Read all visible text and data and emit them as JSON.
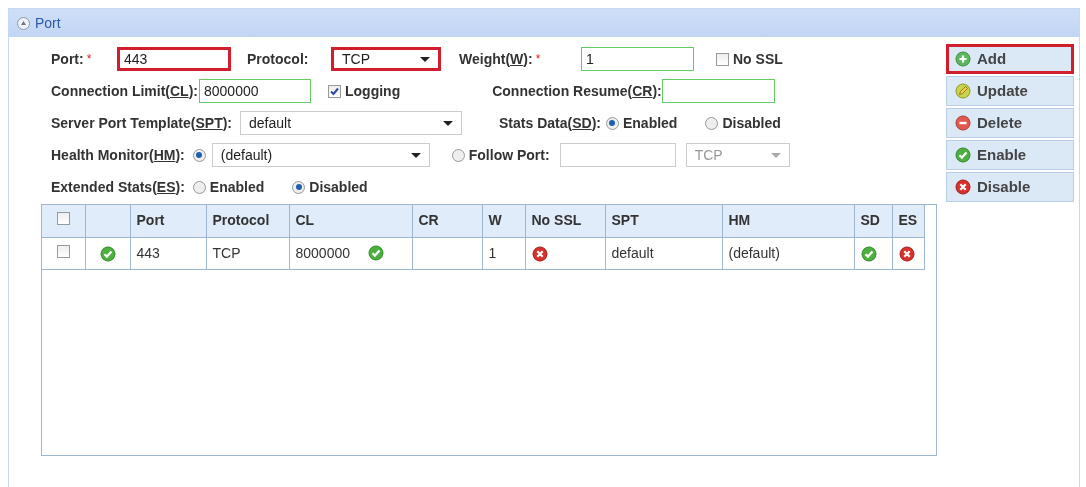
{
  "panel": {
    "title": "Port",
    "collapsed": false
  },
  "form": {
    "port": {
      "label": "Port:",
      "required": "*",
      "value": "443",
      "highlighted": true
    },
    "protocol": {
      "label": "Protocol:",
      "value": "TCP",
      "highlighted": true
    },
    "weight": {
      "label": [
        "Weight(",
        "W",
        "):"
      ],
      "required": "*",
      "value": "1",
      "highlighted": false
    },
    "no_ssl": {
      "label": "No SSL",
      "checked": false
    },
    "connection_limit": {
      "label": [
        "Connection Limit(",
        "CL",
        "):"
      ],
      "value": "8000000",
      "highlighted": false
    },
    "logging": {
      "label": "Logging",
      "checked": true
    },
    "connection_resume": {
      "label": [
        "Connection Resume(",
        "CR",
        "):"
      ],
      "highlighted": false
    },
    "server_port_template": {
      "label": [
        "Server Port Template(",
        "SPT",
        "):"
      ],
      "value": "default"
    },
    "stats_data": {
      "label": [
        "Stats Data(",
        "SD",
        "):"
      ],
      "options": [
        {
          "label": "Enabled",
          "selected": true
        },
        {
          "label": "Disabled",
          "selected": false
        }
      ]
    },
    "health_monitor": {
      "label": [
        "Health Monitor(",
        "HM",
        "):"
      ],
      "options": [
        {
          "kind": "select",
          "value": "(default)",
          "selected": true
        },
        {
          "kind": "follow_port",
          "label": "Follow Port:",
          "protocol": "TCP",
          "selected": false
        }
      ]
    },
    "extended_stats": {
      "label": [
        "Extended Stats(",
        "ES",
        "):"
      ],
      "options": [
        {
          "label": "Enabled",
          "selected": false
        },
        {
          "label": "Disabled",
          "selected": true
        }
      ]
    }
  },
  "buttons": [
    {
      "label": "Add",
      "kind": "add",
      "highlighted": true
    },
    {
      "label": "Update",
      "kind": "update",
      "highlighted": false
    },
    {
      "label": "Delete",
      "kind": "delete",
      "highlighted": false
    },
    {
      "label": "Enable",
      "kind": "enable",
      "highlighted": false
    },
    {
      "label": "Disable",
      "kind": "disable",
      "highlighted": false
    }
  ],
  "table": {
    "header_checked": false,
    "columns": [
      "Port",
      "Protocol",
      "CL",
      "CR",
      "W",
      "No SSL",
      "SPT",
      "HM",
      "SD",
      "ES"
    ],
    "rows": [
      {
        "checked": false,
        "enabled": true,
        "port": "443",
        "protocol": "TCP",
        "cl": "8000000",
        "cl_ok": true,
        "w": "1",
        "no_ssl": false,
        "spt": "default",
        "hm": "(default)",
        "sd": true,
        "es": false
      }
    ]
  }
}
